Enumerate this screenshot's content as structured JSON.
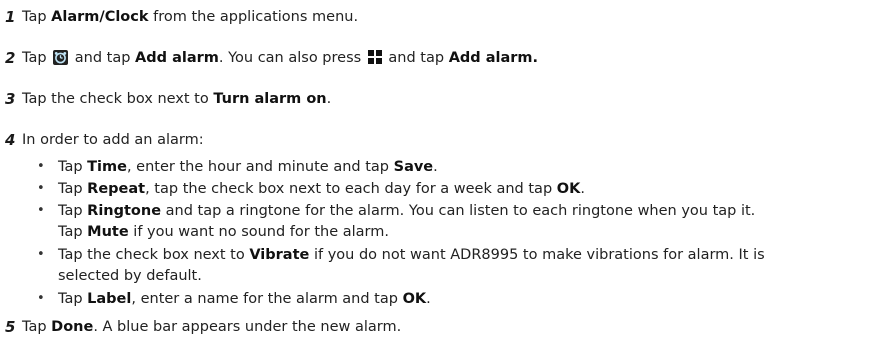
{
  "steps": [
    {
      "num": "1",
      "pre": "Tap ",
      "bold1": "Alarm/Clock",
      "post": " from the applications menu."
    },
    {
      "num": "2",
      "pre": "Tap ",
      "mid1": " and tap ",
      "bold1": "Add alarm",
      "mid2": ". You can also press ",
      "mid3": " and tap ",
      "bold2": "Add alarm."
    },
    {
      "num": "3",
      "pre": "Tap the check box next to ",
      "bold1": "Turn alarm on",
      "post": "."
    },
    {
      "num": "4",
      "text": "In order to add an alarm:"
    },
    {
      "num": "5",
      "pre": "Tap ",
      "bold1": "Done",
      "post": ". A blue bar appears under the new alarm."
    }
  ],
  "bullets": {
    "symbol": "•",
    "time": {
      "pre": "Tap ",
      "b1": "Time",
      "mid": ", enter the hour and minute and tap ",
      "b2": "Save",
      "post": "."
    },
    "repeat": {
      "pre": "Tap ",
      "b1": "Repeat",
      "mid": ", tap the check box next to each day for a week and tap ",
      "b2": "OK",
      "post": "."
    },
    "ringtone": {
      "pre": "Tap ",
      "b1": "Ringtone",
      "mid": " and tap a ringtone for the alarm. You can listen to each ringtone when you tap it.",
      "line2_pre": "Tap ",
      "b2": "Mute",
      "line2_post": " if you want no sound for the alarm."
    },
    "vibrate": {
      "pre": "Tap the check box next to ",
      "b1": "Vibrate",
      "mid": " if you do not want ADR8995 to make vibrations for alarm. It is",
      "line2": "selected by default."
    },
    "label": {
      "pre": "Tap ",
      "b1": "Label",
      "mid": ", enter a name for the alarm and tap ",
      "b2": "OK",
      "post": "."
    }
  },
  "icons": {
    "alarm_icon": "alarm-clock-icon",
    "menu_icon": "menu-grid-icon"
  }
}
